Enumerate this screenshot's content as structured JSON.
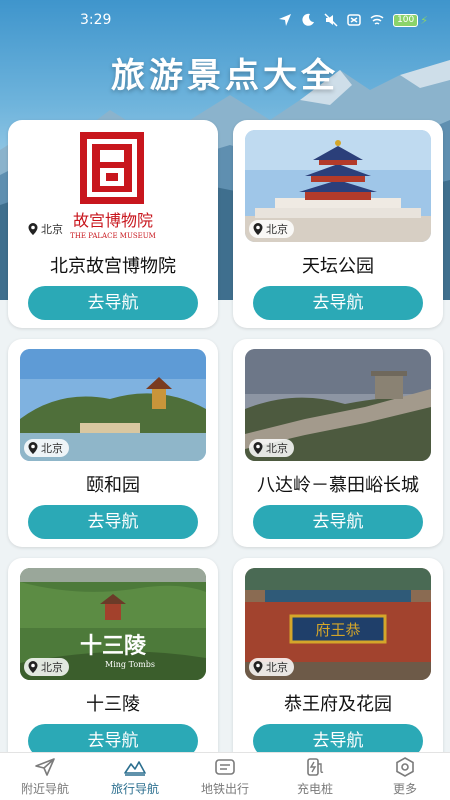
{
  "status": {
    "time": "3:29",
    "battery": "100"
  },
  "title": "旅游景点大全",
  "cards": [
    {
      "name": "北京故宫博物院",
      "city": "北京",
      "button": "去导航",
      "logo_text": "故宫博物院",
      "logo_sub": "THE PALACE MUSEUM"
    },
    {
      "name": "天坛公园",
      "city": "北京",
      "button": "去导航"
    },
    {
      "name": "颐和园",
      "city": "北京",
      "button": "去导航"
    },
    {
      "name": "八达岭－慕田峪长城",
      "city": "北京",
      "button": "去导航"
    },
    {
      "name": "十三陵",
      "city": "北京",
      "button": "去导航",
      "overlay": "十三陵",
      "overlay_sub": "Ming Tombs"
    },
    {
      "name": "恭王府及花园",
      "city": "北京",
      "button": "去导航",
      "plaque": "府王恭"
    }
  ],
  "tabs": [
    {
      "label": "附近导航",
      "icon": "send-icon"
    },
    {
      "label": "旅行导航",
      "icon": "mountain-icon",
      "active": true
    },
    {
      "label": "地铁出行",
      "icon": "ticket-icon"
    },
    {
      "label": "充电桩",
      "icon": "charger-icon"
    },
    {
      "label": "更多",
      "icon": "hexagon-icon"
    }
  ],
  "colors": {
    "accent": "#2ba9b6",
    "active_tab": "#2c6f8f",
    "logo_red": "#c8161d"
  }
}
